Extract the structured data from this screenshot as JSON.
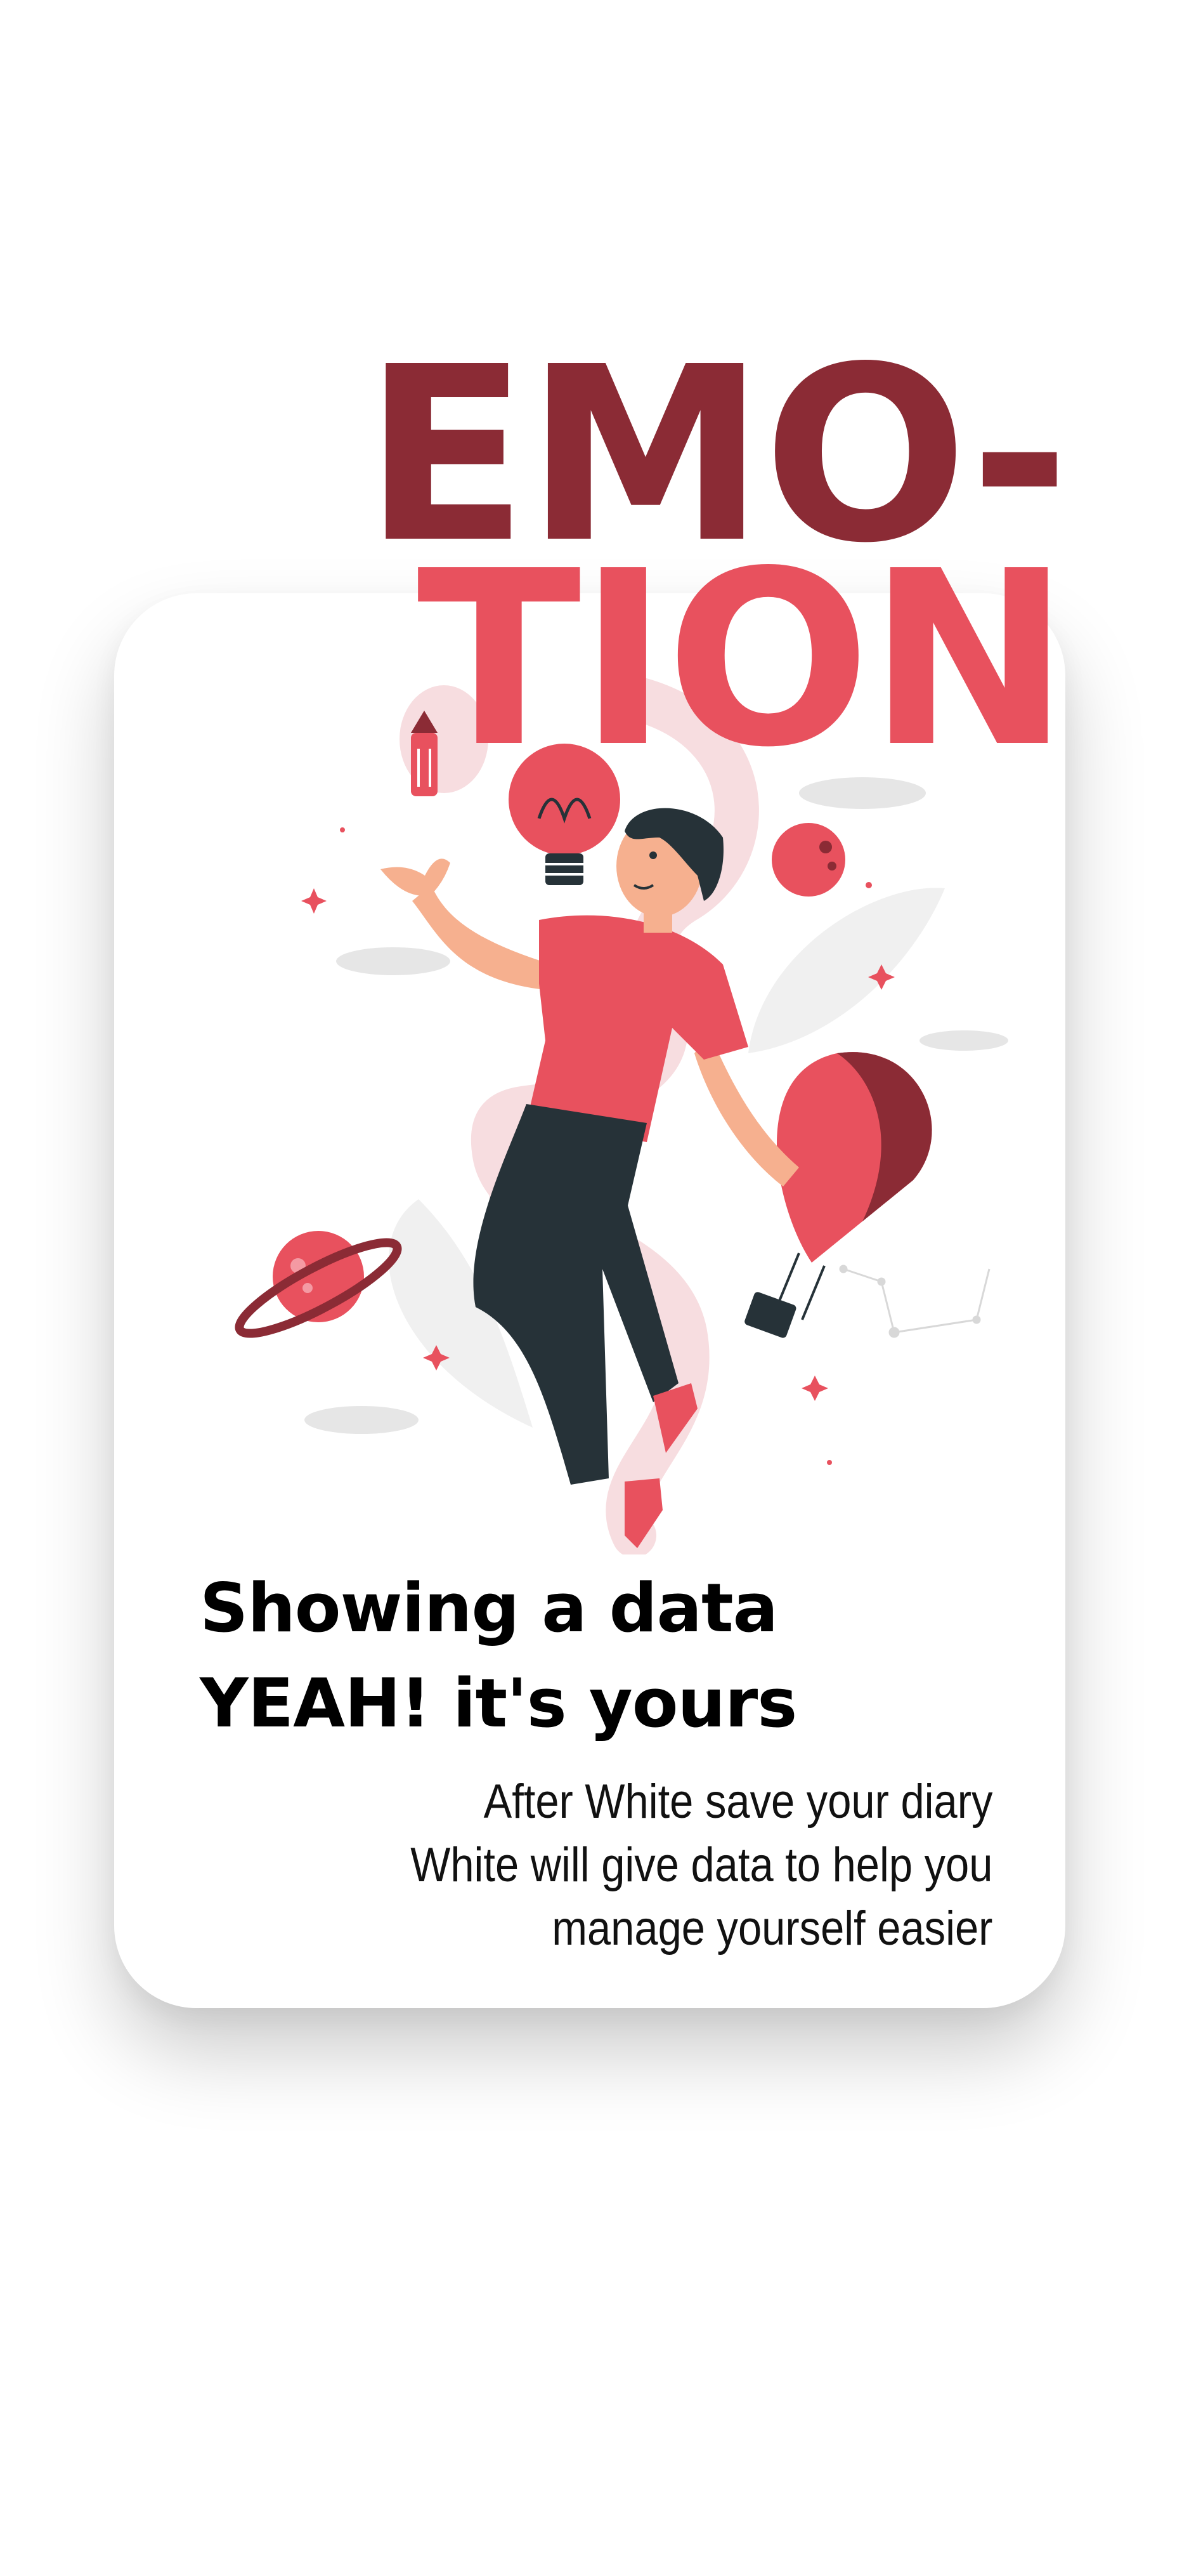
{
  "colors": {
    "background": "#ffffff",
    "card": "#ffffff",
    "accent_dark": "#8b2b35",
    "accent": "#e8515e",
    "text": "#000000"
  },
  "headline": {
    "line1": "EMO-",
    "line2": "TION"
  },
  "illustration": {
    "icons": [
      "pencil-icon",
      "lightbulb-icon",
      "planet-icon",
      "hot-air-balloon-icon",
      "moon-icon",
      "leaf-icon",
      "sparkle-icon",
      "cloud-icon"
    ]
  },
  "title": {
    "line1": "Showing a data",
    "line2": "YEAH! it's yours"
  },
  "description": {
    "line1": "After White save your diary",
    "line2": "White will give data to help you",
    "line3": "manage yourself easier"
  }
}
